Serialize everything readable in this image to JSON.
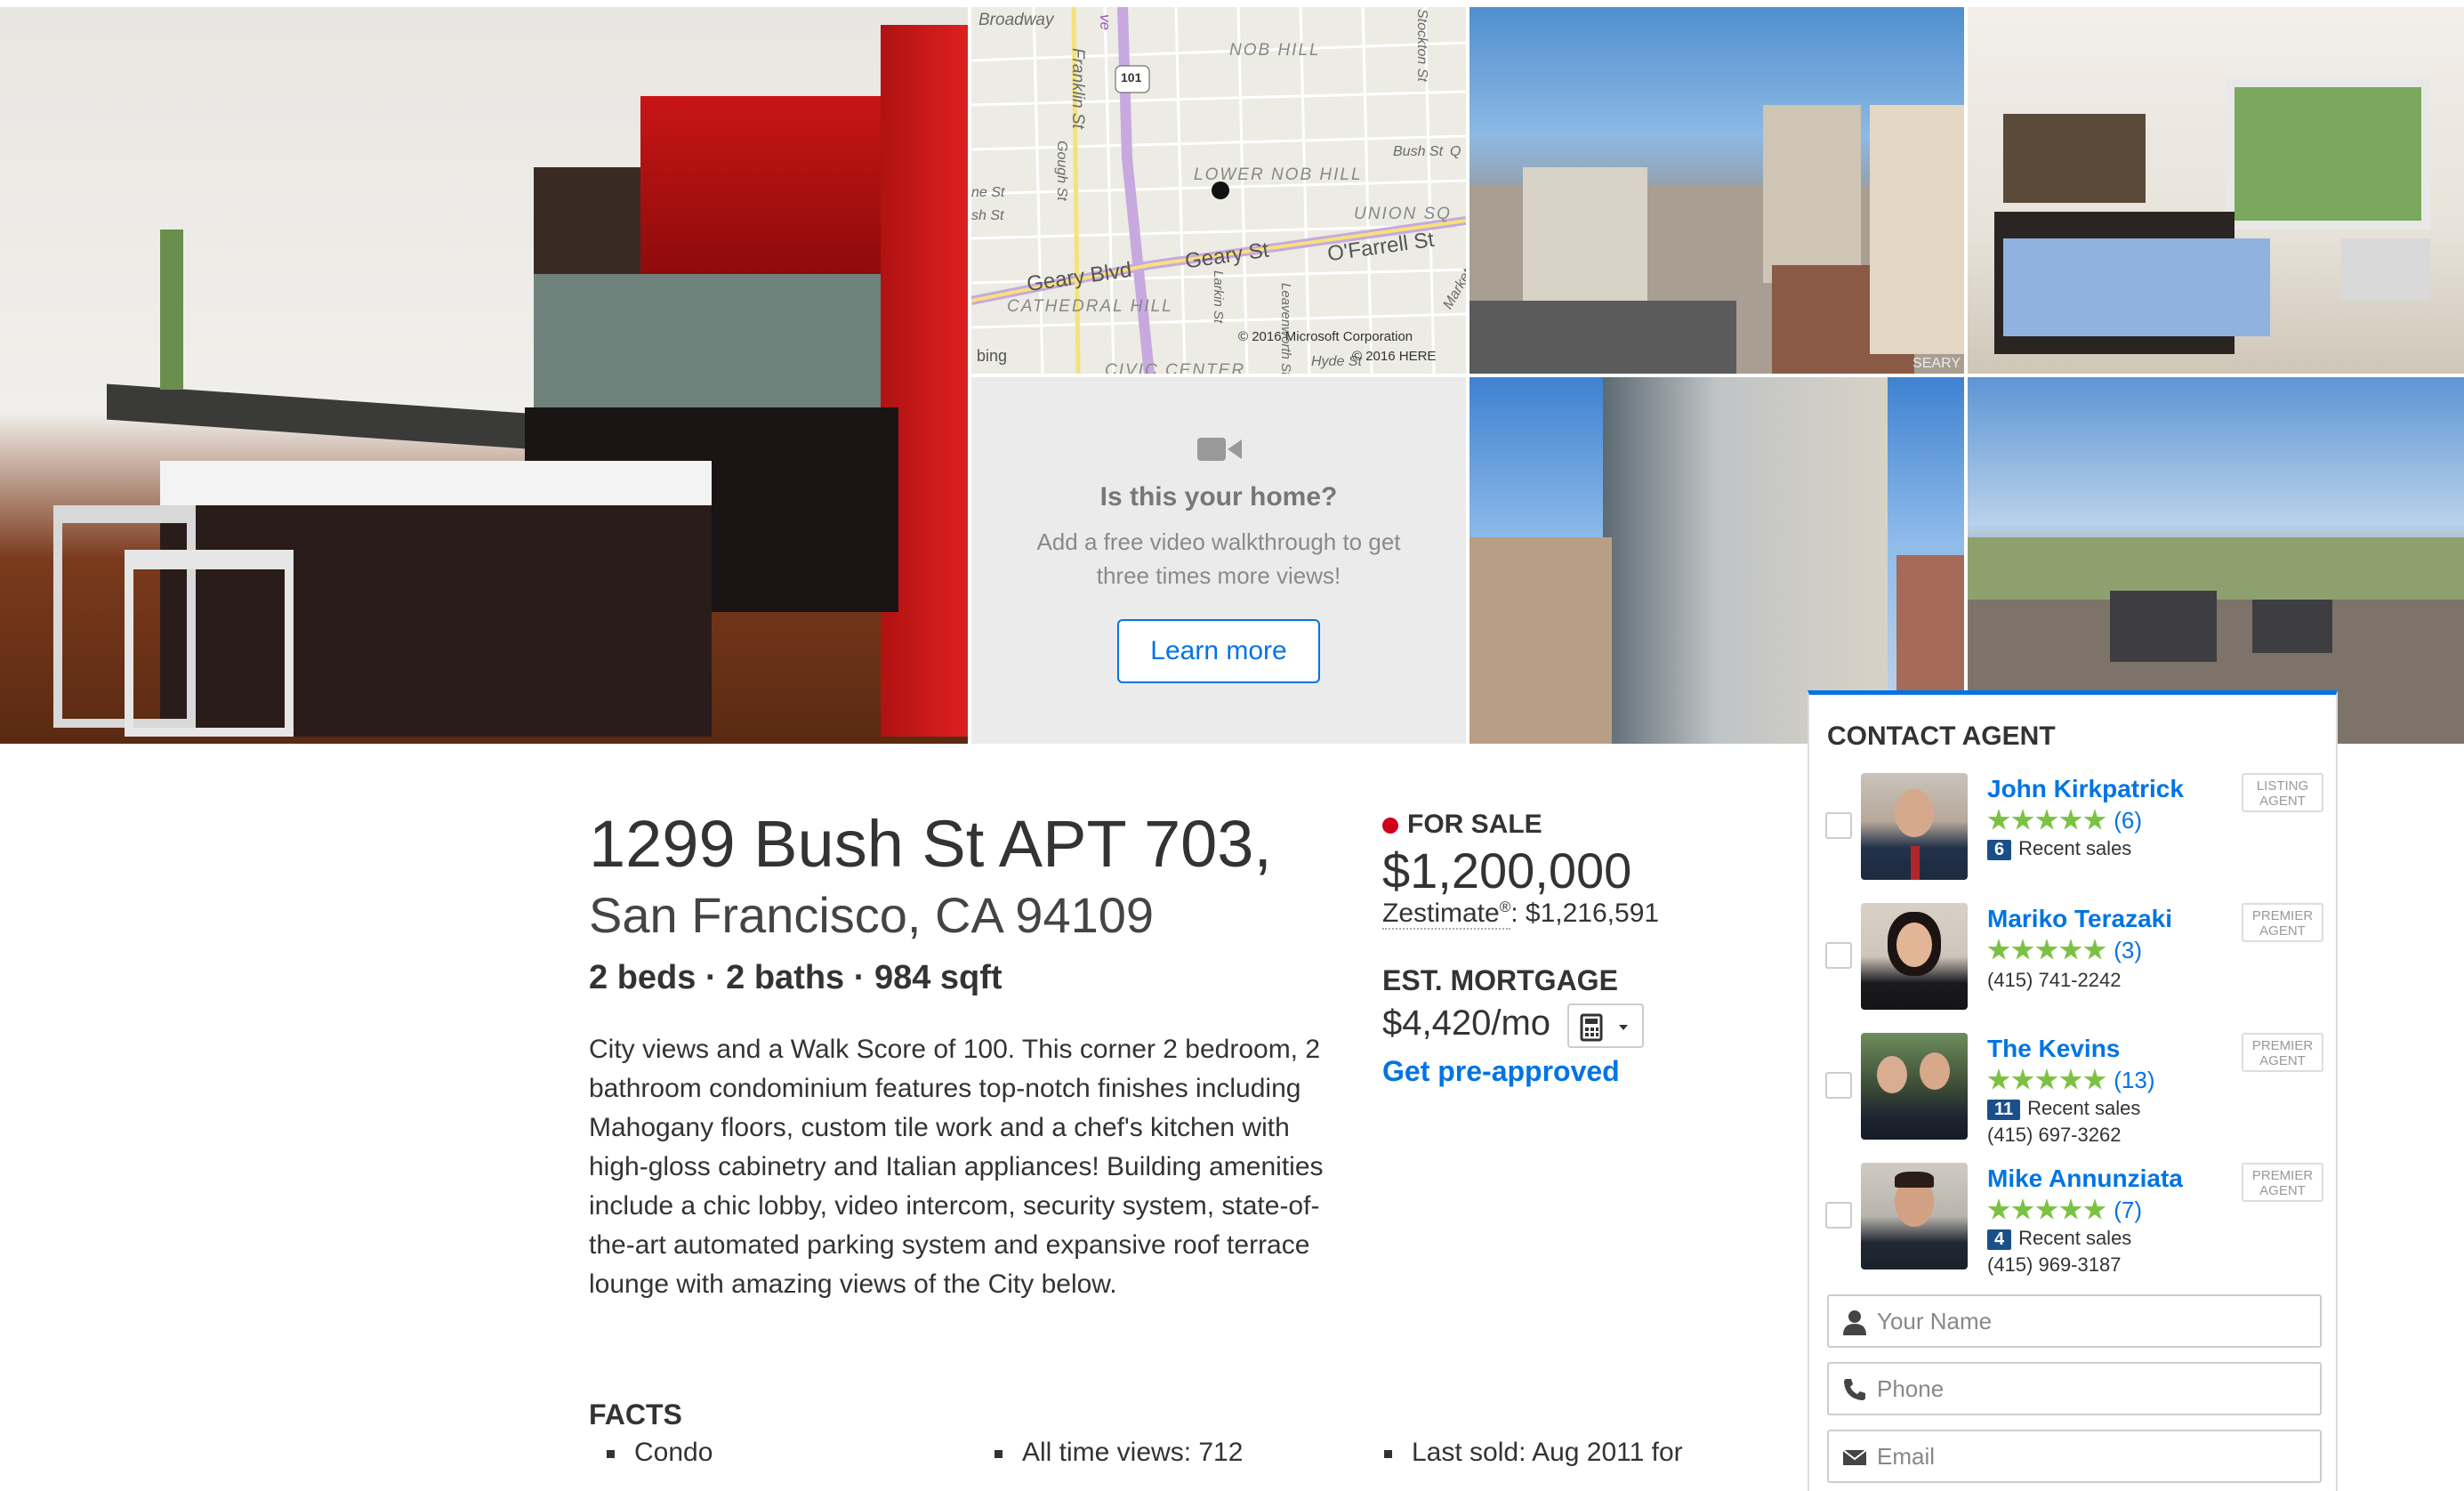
{
  "gallery": {
    "video_cta": {
      "title": "Is this your home?",
      "text": "Add a free video walkthrough to get three times more views!",
      "button_label": "Learn more"
    },
    "map": {
      "streets": [
        "Broadway",
        "Franklin St",
        "Gough St",
        "Geary Blvd",
        "Geary St",
        "O'Farrell St",
        "Bush St",
        "Larkin St",
        "Leavenworth St",
        "Stockton St",
        "Market St",
        "Hyde St"
      ],
      "neighborhoods": [
        "NOB HILL",
        "LOWER NOB HILL",
        "UNION SQ",
        "CATHEDRAL HILL",
        "CIVIC CENTER"
      ],
      "highway_shield": "101",
      "partial_labels": [
        "ve",
        "ne St",
        "sh St",
        "Q"
      ],
      "brand": "bing",
      "copyright_1": "© 2016 Microsoft Corporation",
      "copyright_2": "© 2016 HERE"
    },
    "watermark": "SEARY"
  },
  "listing": {
    "address_line1": "1299 Bush St APT 703,",
    "address_line2": "San Francisco, CA 94109",
    "beds_baths_sqft": "2 beds · 2 baths · 984 sqft",
    "description": "City views and a Walk Score of 100. This corner 2 bedroom, 2 bathroom condominium features top-notch finishes including Mahogany floors, custom tile work and a chef's kitchen with high-gloss cabinetry and Italian appliances! Building amenities include a chic lobby, video intercom, security system, state-of-the-art automated parking system and expansive roof terrace lounge with amazing views of the City below.",
    "facts_heading": "FACTS",
    "facts": [
      "Condo",
      "All time views: 712",
      "Last sold: Aug 2011 for"
    ]
  },
  "price_box": {
    "status": "FOR SALE",
    "status_color": "#d0021b",
    "price": "$1,200,000",
    "zestimate_label": "Zestimate",
    "zestimate_reg": "®",
    "zestimate_value": ": $1,216,591",
    "mortgage_heading": "EST. MORTGAGE",
    "mortgage_value": "$4,420/mo",
    "calculator_icon": "calculator-icon",
    "preapproved_link": "Get pre-approved",
    "link_color": "#0074e4"
  },
  "contact_agent": {
    "title": "CONTACT AGENT",
    "star_color": "#7bc143",
    "agents": [
      {
        "name": "John Kirkpatrick",
        "stars": 5,
        "reviews": "(6)",
        "sales_count": "6",
        "sales_label": "Recent sales",
        "phone": "",
        "badge_line1": "LISTING",
        "badge_line2": "AGENT"
      },
      {
        "name": "Mariko Terazaki",
        "stars": 5,
        "reviews": "(3)",
        "sales_count": "",
        "sales_label": "",
        "phone": "(415) 741-2242",
        "badge_line1": "PREMIER",
        "badge_line2": "AGENT"
      },
      {
        "name": "The Kevins",
        "stars": 5,
        "reviews": "(13)",
        "sales_count": "11",
        "sales_label": "Recent sales",
        "phone": "(415) 697-3262",
        "badge_line1": "PREMIER",
        "badge_line2": "AGENT"
      },
      {
        "name": "Mike Annunziata",
        "stars": 5,
        "reviews": "(7)",
        "sales_count": "4",
        "sales_label": "Recent sales",
        "phone": "(415) 969-3187",
        "badge_line1": "PREMIER",
        "badge_line2": "AGENT"
      }
    ],
    "fields": [
      {
        "icon": "person-icon",
        "placeholder": "Your Name"
      },
      {
        "icon": "phone-icon",
        "placeholder": "Phone"
      },
      {
        "icon": "envelope-icon",
        "placeholder": "Email"
      }
    ]
  }
}
